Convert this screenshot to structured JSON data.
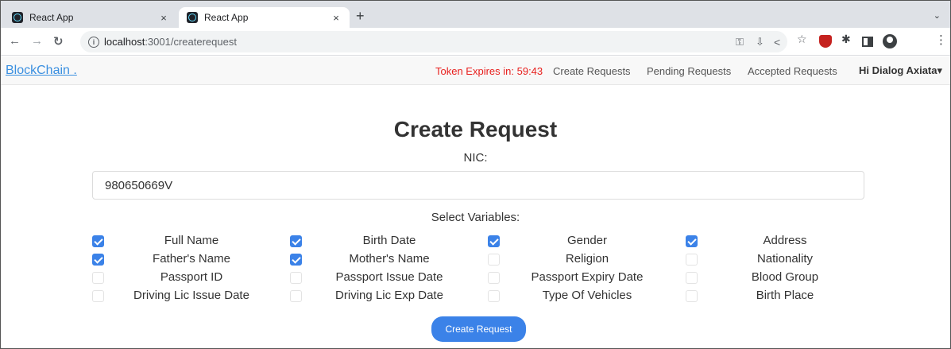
{
  "browser": {
    "tabs": [
      {
        "title": "React App",
        "active": false
      },
      {
        "title": "React App",
        "active": true
      }
    ],
    "tab_close_glyph": "×",
    "new_tab_glyph": "+",
    "tab_menu_glyph": "⌄",
    "url_host": "localhost",
    "url_path": ":3001/createrequest",
    "info_glyph": "i"
  },
  "navbar": {
    "brand": "BlockChain .",
    "token_label": "Token Expires in: 59:43",
    "links": [
      "Create Requests",
      "Pending Requests",
      "Accepted Requests"
    ],
    "user": "Hi Dialog Axiata▾"
  },
  "form": {
    "title": "Create Request",
    "nic_label": "NIC:",
    "nic_value": "980650669V",
    "variables_label": "Select Variables:",
    "variables": [
      {
        "label": "Full Name",
        "checked": true
      },
      {
        "label": "Birth Date",
        "checked": true
      },
      {
        "label": "Gender",
        "checked": true
      },
      {
        "label": "Address",
        "checked": true
      },
      {
        "label": "Father's Name",
        "checked": true
      },
      {
        "label": "Mother's Name",
        "checked": true
      },
      {
        "label": "Religion",
        "checked": false
      },
      {
        "label": "Nationality",
        "checked": false
      },
      {
        "label": "Passport ID",
        "checked": false
      },
      {
        "label": "Passport Issue Date",
        "checked": false
      },
      {
        "label": "Passport Expiry Date",
        "checked": false
      },
      {
        "label": "Blood Group",
        "checked": false
      },
      {
        "label": "Driving Lic Issue Date",
        "checked": false
      },
      {
        "label": "Driving Lic Exp Date",
        "checked": false
      },
      {
        "label": "Type Of Vehicles",
        "checked": false
      },
      {
        "label": "Birth Place",
        "checked": false
      }
    ],
    "submit_label": "Create Request"
  },
  "colors": {
    "accent": "#3b82e8",
    "token": "#e8201e",
    "brand": "#3a8fe0"
  }
}
